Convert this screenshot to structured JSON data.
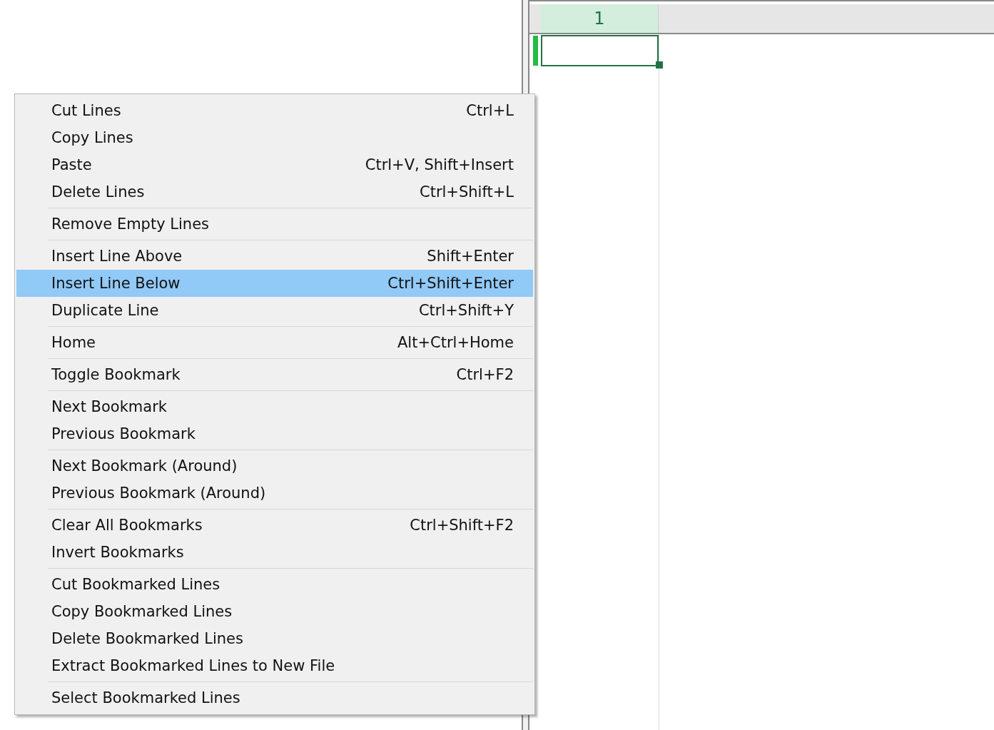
{
  "sheet": {
    "columns": [
      {
        "label": "1",
        "selected": true
      }
    ]
  },
  "context_menu": {
    "groups": [
      [
        {
          "label": "Cut Lines",
          "shortcut": "Ctrl+L",
          "selected": false
        },
        {
          "label": "Copy Lines",
          "selected": false
        },
        {
          "label": "Paste",
          "shortcut": "Ctrl+V, Shift+Insert",
          "selected": false
        },
        {
          "label": "Delete Lines",
          "shortcut": "Ctrl+Shift+L",
          "selected": false
        }
      ],
      [
        {
          "label": "Remove Empty Lines",
          "selected": false
        }
      ],
      [
        {
          "label": "Insert Line Above",
          "shortcut": "Shift+Enter",
          "selected": false
        },
        {
          "label": "Insert Line Below",
          "shortcut": "Ctrl+Shift+Enter",
          "selected": true
        },
        {
          "label": "Duplicate Line",
          "shortcut": "Ctrl+Shift+Y",
          "selected": false
        }
      ],
      [
        {
          "label": "Home",
          "shortcut": "Alt+Ctrl+Home",
          "selected": false
        }
      ],
      [
        {
          "label": "Toggle Bookmark",
          "shortcut": "Ctrl+F2",
          "selected": false
        }
      ],
      [
        {
          "label": "Next Bookmark",
          "selected": false
        },
        {
          "label": "Previous Bookmark",
          "selected": false
        }
      ],
      [
        {
          "label": "Next Bookmark (Around)",
          "selected": false
        },
        {
          "label": "Previous Bookmark (Around)",
          "selected": false
        }
      ],
      [
        {
          "label": "Clear All Bookmarks",
          "shortcut": "Ctrl+Shift+F2",
          "selected": false
        },
        {
          "label": "Invert Bookmarks",
          "selected": false
        }
      ],
      [
        {
          "label": "Cut Bookmarked Lines",
          "selected": false
        },
        {
          "label": "Copy Bookmarked Lines",
          "selected": false
        },
        {
          "label": "Delete Bookmarked Lines",
          "selected": false
        },
        {
          "label": "Extract Bookmarked Lines to New File",
          "selected": false
        }
      ],
      [
        {
          "label": "Select Bookmarked Lines",
          "selected": false
        }
      ]
    ]
  }
}
